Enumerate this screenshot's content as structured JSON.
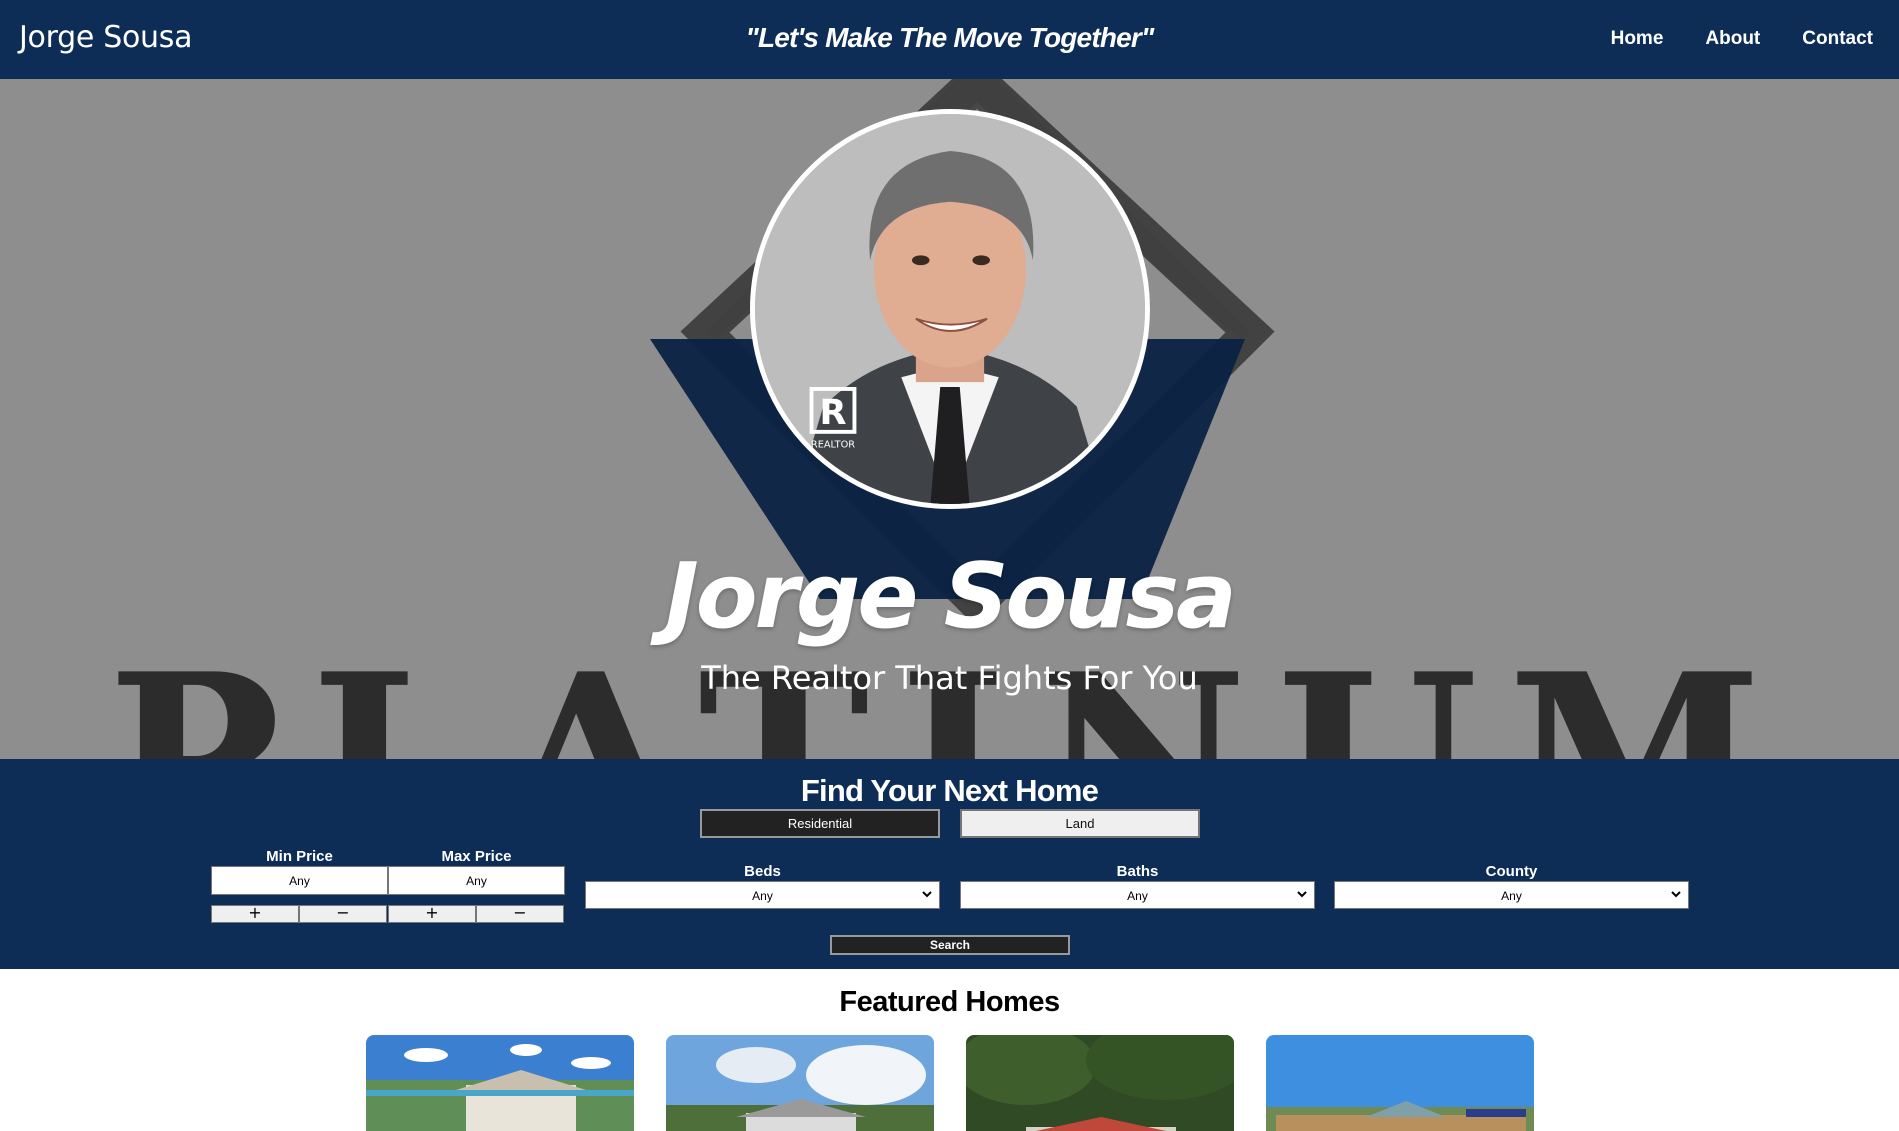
{
  "nav": {
    "brand": "Jorge Sousa",
    "tagline": "\"Let's Make The Move Together\"",
    "links": [
      {
        "label": "Home"
      },
      {
        "label": "About"
      },
      {
        "label": "Contact"
      }
    ]
  },
  "hero": {
    "name": "Jorge Sousa",
    "subtitle": "The Realtor That Fights For You",
    "background_logo_text": "PLATINUM",
    "badge_text": "REALTOR",
    "badge_letter": "R"
  },
  "search": {
    "title": "Find Your Next Home",
    "types": [
      {
        "label": "Residential",
        "active": true
      },
      {
        "label": "Land",
        "active": false
      }
    ],
    "min_price": {
      "label": "Min Price",
      "value": "Any",
      "plus": "+",
      "minus": "−"
    },
    "max_price": {
      "label": "Max Price",
      "value": "Any",
      "plus": "+",
      "minus": "−"
    },
    "beds": {
      "label": "Beds",
      "value": "Any"
    },
    "baths": {
      "label": "Baths",
      "value": "Any"
    },
    "county": {
      "label": "County",
      "value": "Any"
    },
    "submit_label": "Search"
  },
  "featured": {
    "title": "Featured Homes"
  },
  "colors": {
    "navy": "#0d2d57",
    "hero_gray": "#8e8e8e",
    "button_dark": "#222222"
  }
}
